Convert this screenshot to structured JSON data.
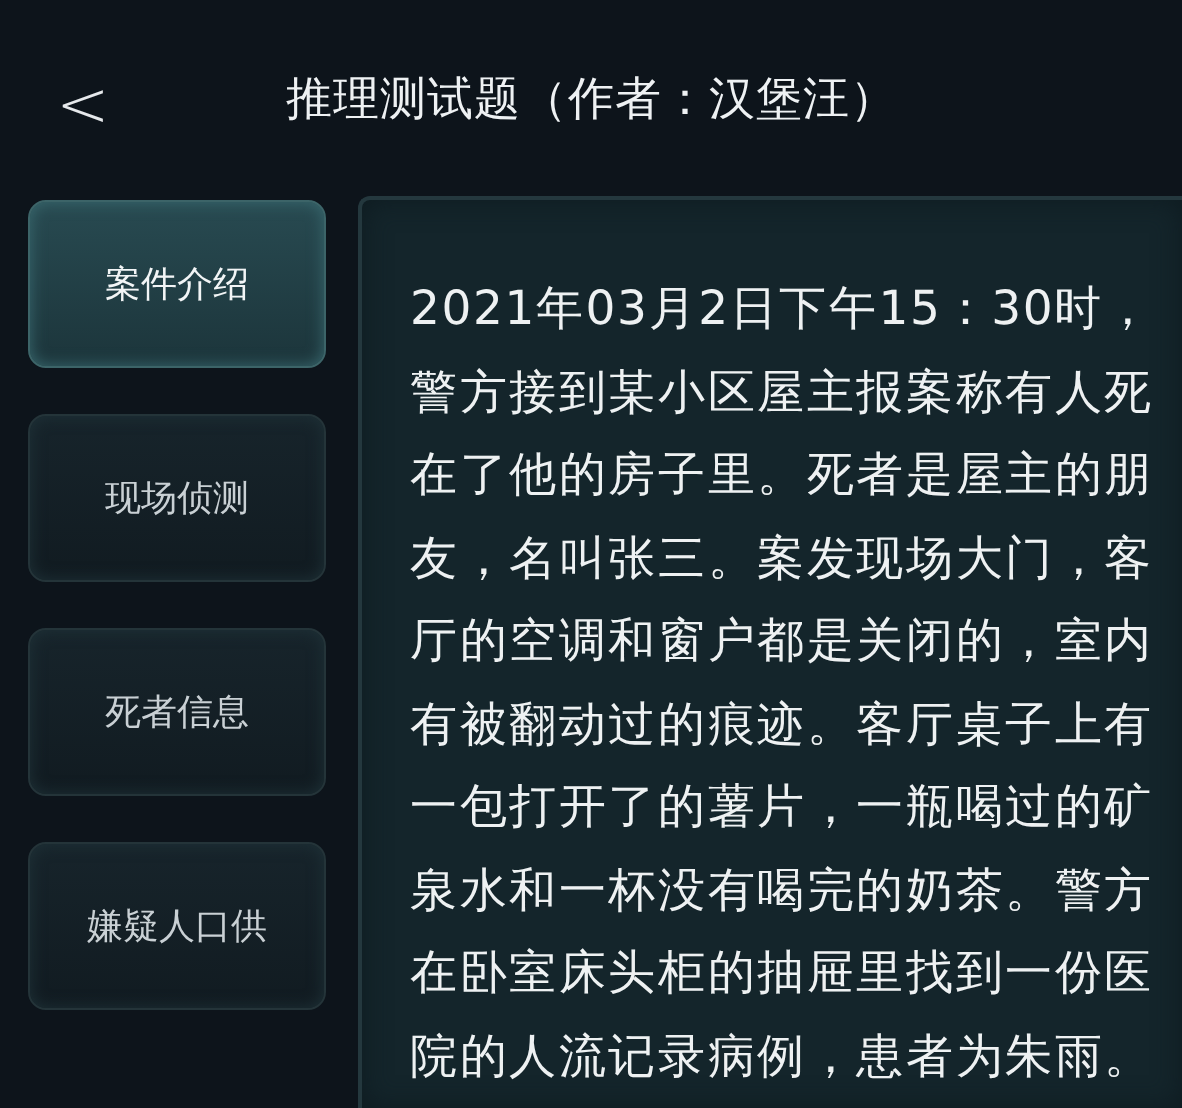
{
  "header": {
    "back": "<",
    "title": "推理测试题（作者：汉堡汪）"
  },
  "tabs": [
    {
      "label": "案件介绍",
      "selected": true
    },
    {
      "label": "现场侦测",
      "selected": false
    },
    {
      "label": "死者信息",
      "selected": false
    },
    {
      "label": "嫌疑人口供",
      "selected": false
    }
  ],
  "content": {
    "text": "2021年03月2日下午15：30时，警方接到某小区屋主报案称有人死在了他的房子里。死者是屋主的朋友，名叫张三。案发现场大门，客厅的空调和窗户都是关闭的，室内有被翻动过的痕迹。客厅桌子上有一包打开了的薯片，一瓶喝过的矿泉水和一杯没有喝完的奶茶。警方在卧室床头柜的抽屉里找到一份医院的人流记录病例，患者为朱雨。"
  }
}
